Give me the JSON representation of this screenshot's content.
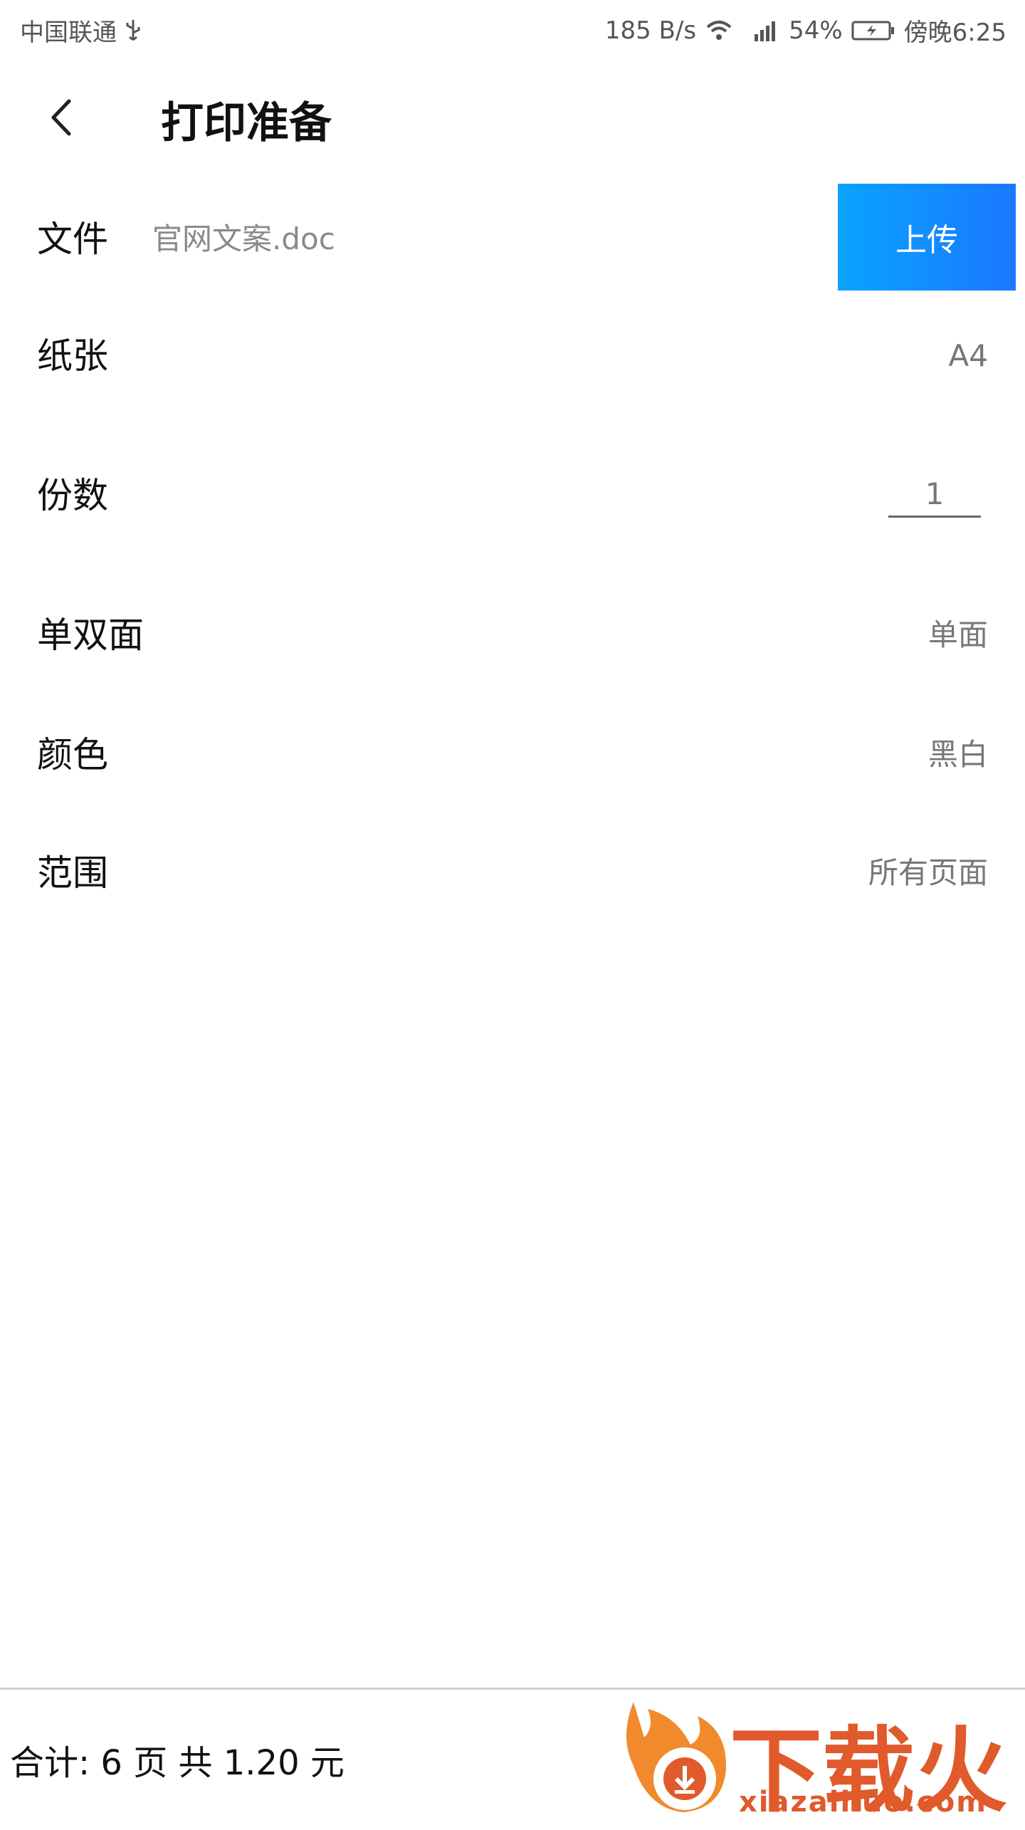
{
  "status_bar": {
    "carrier": "中国联通",
    "speed": "185 B/s",
    "network": "4G",
    "battery": "54%",
    "time": "傍晚6:25"
  },
  "header": {
    "title": "打印准备"
  },
  "form": {
    "file": {
      "label": "文件",
      "value": "官网文案.doc",
      "upload_label": "上传"
    },
    "paper": {
      "label": "纸张",
      "value": "A4"
    },
    "copies": {
      "label": "份数",
      "value": "1"
    },
    "duplex": {
      "label": "单双面",
      "value": "单面"
    },
    "color": {
      "label": "颜色",
      "value": "黑白"
    },
    "range": {
      "label": "范围",
      "value": "所有页面"
    }
  },
  "footer": {
    "total": "合计: 6 页 共 1.20 元"
  },
  "watermark": {
    "brand": "下载火",
    "site": "xiazaihuo.com"
  },
  "colors": {
    "accent_start": "#0aa3ff",
    "accent_end": "#1a78ff",
    "watermark": "#e05a2b"
  }
}
